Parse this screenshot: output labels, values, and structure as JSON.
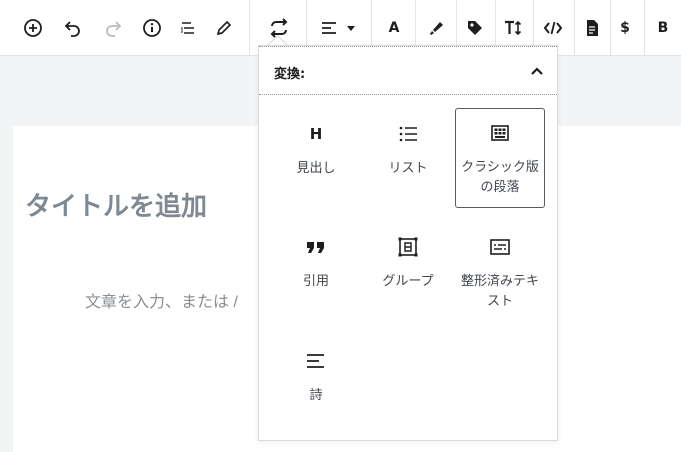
{
  "toolbar": {
    "items": [
      {
        "name": "add-block",
        "icon": "plus-circle-icon"
      },
      {
        "name": "undo",
        "icon": "undo-icon"
      },
      {
        "name": "redo",
        "icon": "redo-icon"
      },
      {
        "name": "info",
        "icon": "info-icon"
      },
      {
        "name": "outline",
        "icon": "list-outline-icon"
      },
      {
        "name": "tools",
        "icon": "pencil-icon"
      },
      {
        "name": "transform",
        "icon": "transform-icon"
      },
      {
        "name": "align",
        "icon": "align-left-icon"
      },
      {
        "name": "font",
        "icon": "letter-a-icon"
      },
      {
        "name": "highlight",
        "icon": "highlighter-icon"
      },
      {
        "name": "tag",
        "icon": "tag-icon"
      },
      {
        "name": "text-size",
        "icon": "text-size-icon"
      },
      {
        "name": "code",
        "icon": "code-icon"
      },
      {
        "name": "document",
        "icon": "document-icon"
      },
      {
        "name": "price",
        "icon": "dollar-icon"
      },
      {
        "name": "bold",
        "icon": "bold-icon"
      }
    ],
    "font_letter": "A",
    "price_symbol": "$",
    "bold_letter": "B"
  },
  "editor": {
    "title_placeholder": "タイトルを追加",
    "body_placeholder": "文章を入力、または /"
  },
  "popover": {
    "title": "変換:",
    "blocks": [
      {
        "label": "見出し",
        "icon": "heading-icon",
        "glyph": "H",
        "selected": false
      },
      {
        "label": "リスト",
        "icon": "list-icon",
        "selected": false
      },
      {
        "label": "クラシック版の段落",
        "icon": "classic-icon",
        "selected": true
      },
      {
        "label": "引用",
        "icon": "quote-icon",
        "selected": false
      },
      {
        "label": "グループ",
        "icon": "group-icon",
        "selected": false
      },
      {
        "label": "整形済みテキスト",
        "icon": "preformatted-icon",
        "selected": false
      },
      {
        "label": "詩",
        "icon": "verse-icon",
        "selected": false
      }
    ]
  },
  "colors": {
    "icon": "#1e1e1e",
    "disabled_icon": "#b5bcc2",
    "border": "#e2e4e7",
    "placeholder": "#7e8993"
  }
}
